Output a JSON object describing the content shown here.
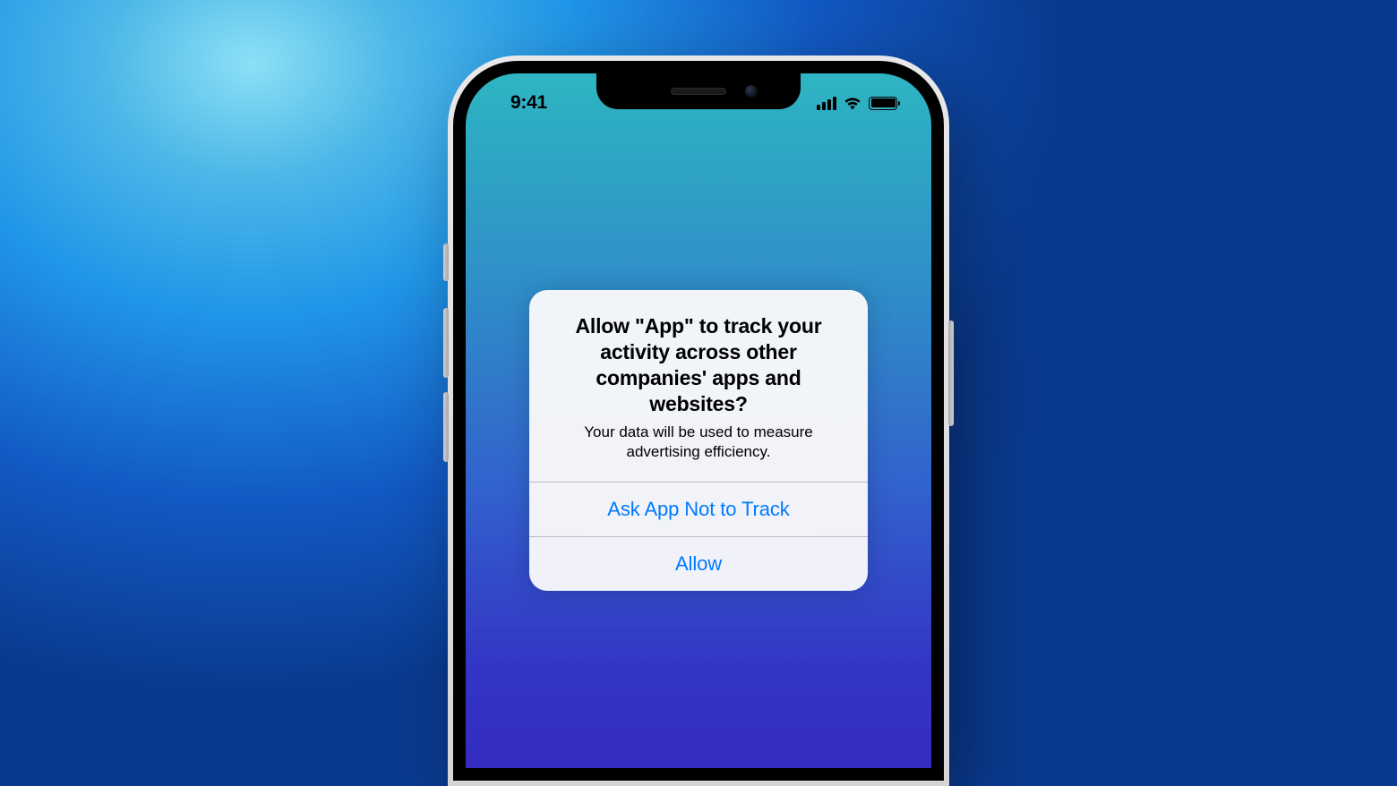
{
  "status_bar": {
    "time": "9:41"
  },
  "alert": {
    "title": "Allow \"App\" to track your activity across other companies' apps and websites?",
    "message": "Your data will be used to measure advertising efficiency.",
    "deny_label": "Ask App Not to Track",
    "allow_label": "Allow"
  }
}
